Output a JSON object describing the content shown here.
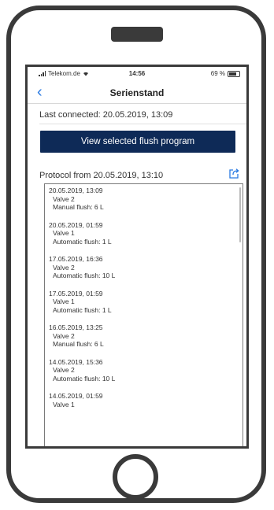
{
  "status_bar": {
    "carrier": "Telekom.de",
    "time": "14:56",
    "battery": "69 %"
  },
  "nav": {
    "title": "Serienstand"
  },
  "last_connected": "Last connected: 20.05.2019, 13:09",
  "button_label": "View selected flush program",
  "protocol_title": "Protocol from 20.05.2019, 13:10",
  "entries": [
    {
      "date": "20.05.2019, 13:09",
      "valve": "Valve 2",
      "flush": "Manual flush: 6 L"
    },
    {
      "date": "20.05.2019, 01:59",
      "valve": "Valve 1",
      "flush": "Automatic flush: 1 L"
    },
    {
      "date": "17.05.2019, 16:36",
      "valve": "Valve 2",
      "flush": "Automatic flush: 10 L"
    },
    {
      "date": "17.05.2019, 01:59",
      "valve": "Valve 1",
      "flush": "Automatic flush: 1 L"
    },
    {
      "date": "16.05.2019, 13:25",
      "valve": "Valve 2",
      "flush": "Manual flush: 6 L"
    },
    {
      "date": "14.05.2019, 15:36",
      "valve": "Valve 2",
      "flush": "Automatic flush: 10 L"
    },
    {
      "date": "14.05.2019, 01:59",
      "valve": "Valve 1",
      "flush": ""
    }
  ],
  "colors": {
    "button_bg": "#0e2a57",
    "accent": "#2a7ae2",
    "frame": "#3a3a3a"
  }
}
